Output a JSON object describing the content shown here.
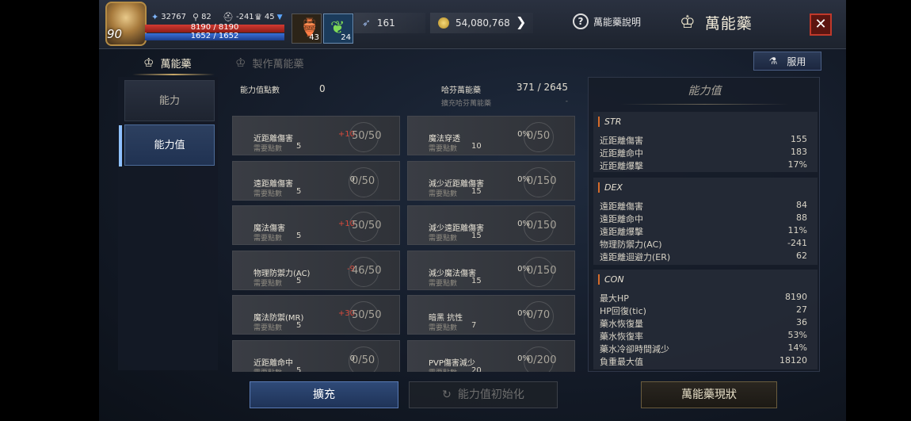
{
  "header": {
    "level": "90",
    "exp": "32767",
    "search_count": "82",
    "ac": "-241",
    "trophy": "45",
    "hp": "8190 / 8190",
    "mp": "1652 / 1652",
    "potion_count": "43",
    "leaf_count": "24",
    "currency1": "161",
    "gold": "54,080,768",
    "help_label": "萬能藥說明",
    "title": "萬能藥"
  },
  "tabs": {
    "tab1": "萬能藥",
    "tab2": "製作萬能藥",
    "use_label": "服用"
  },
  "sidenav": {
    "item1": "能力",
    "item2": "能力值"
  },
  "summary": {
    "points_label": "能力值點數",
    "points_value": "0",
    "haifen_label": "哈芬萬能藥",
    "haifen_value": "371 / 2645",
    "haifen_sub": "擴充哈芬萬能藥",
    "haifen_sub_value": "-"
  },
  "cards_left": [
    {
      "name": "近距離傷害",
      "cost_label": "需要點數",
      "cost": "5",
      "bonus": "+10",
      "progress": "50/50"
    },
    {
      "name": "遠距離傷害",
      "cost_label": "需要點數",
      "cost": "5",
      "bonus": "0",
      "progress": "0/50"
    },
    {
      "name": "魔法傷害",
      "cost_label": "需要點數",
      "cost": "5",
      "bonus": "+10",
      "progress": "50/50"
    },
    {
      "name": "物理防禦力(AC)",
      "cost_label": "需要點數",
      "cost": "5",
      "bonus": "-9",
      "progress": "46/50"
    },
    {
      "name": "魔法防禦(MR)",
      "cost_label": "需要點數",
      "cost": "5",
      "bonus": "+30",
      "progress": "50/50"
    },
    {
      "name": "近距離命中",
      "cost_label": "需要點數",
      "cost": "5",
      "bonus": "0",
      "progress": "0/50"
    }
  ],
  "cards_right": [
    {
      "name": "魔法穿透",
      "cost_label": "需要點數",
      "cost": "10",
      "bonus": "0%",
      "progress": "0/50"
    },
    {
      "name": "減少近距離傷害",
      "cost_label": "需要點數",
      "cost": "15",
      "bonus": "0%",
      "progress": "0/150"
    },
    {
      "name": "減少遠距離傷害",
      "cost_label": "需要點數",
      "cost": "15",
      "bonus": "0%",
      "progress": "0/150"
    },
    {
      "name": "減少魔法傷害",
      "cost_label": "需要點數",
      "cost": "15",
      "bonus": "0%",
      "progress": "0/150"
    },
    {
      "name": "暗黑 抗性",
      "cost_label": "需要點數",
      "cost": "7",
      "bonus": "0%",
      "progress": "0/70"
    },
    {
      "name": "PVP傷害減少",
      "cost_label": "需要點數",
      "cost": "20",
      "bonus": "0%",
      "progress": "0/200"
    }
  ],
  "stats_panel": {
    "title": "能力值",
    "str": {
      "head": "STR",
      "rows": [
        {
          "k": "近距離傷害",
          "v": "155"
        },
        {
          "k": "近距離命中",
          "v": "183"
        },
        {
          "k": "近距離爆擊",
          "v": "17%"
        }
      ]
    },
    "dex": {
      "head": "DEX",
      "rows": [
        {
          "k": "遠距離傷害",
          "v": "84"
        },
        {
          "k": "遠距離命中",
          "v": "88"
        },
        {
          "k": "遠距離爆擊",
          "v": "11%"
        },
        {
          "k": "物理防禦力(AC)",
          "v": "-241"
        },
        {
          "k": "遠距離迴避力(ER)",
          "v": "62"
        }
      ]
    },
    "con": {
      "head": "CON",
      "rows": [
        {
          "k": "最大HP",
          "v": "8190"
        },
        {
          "k": "HP回復(tic)",
          "v": "27"
        },
        {
          "k": "藥水恢復量",
          "v": "36"
        },
        {
          "k": "藥水恢復率",
          "v": "53%"
        },
        {
          "k": "藥水冷卻時間減少",
          "v": "14%"
        },
        {
          "k": "負重最大值",
          "v": "18120"
        }
      ]
    }
  },
  "buttons": {
    "expand": "擴充",
    "reset": "能力值初始化",
    "status": "萬能藥現狀"
  }
}
